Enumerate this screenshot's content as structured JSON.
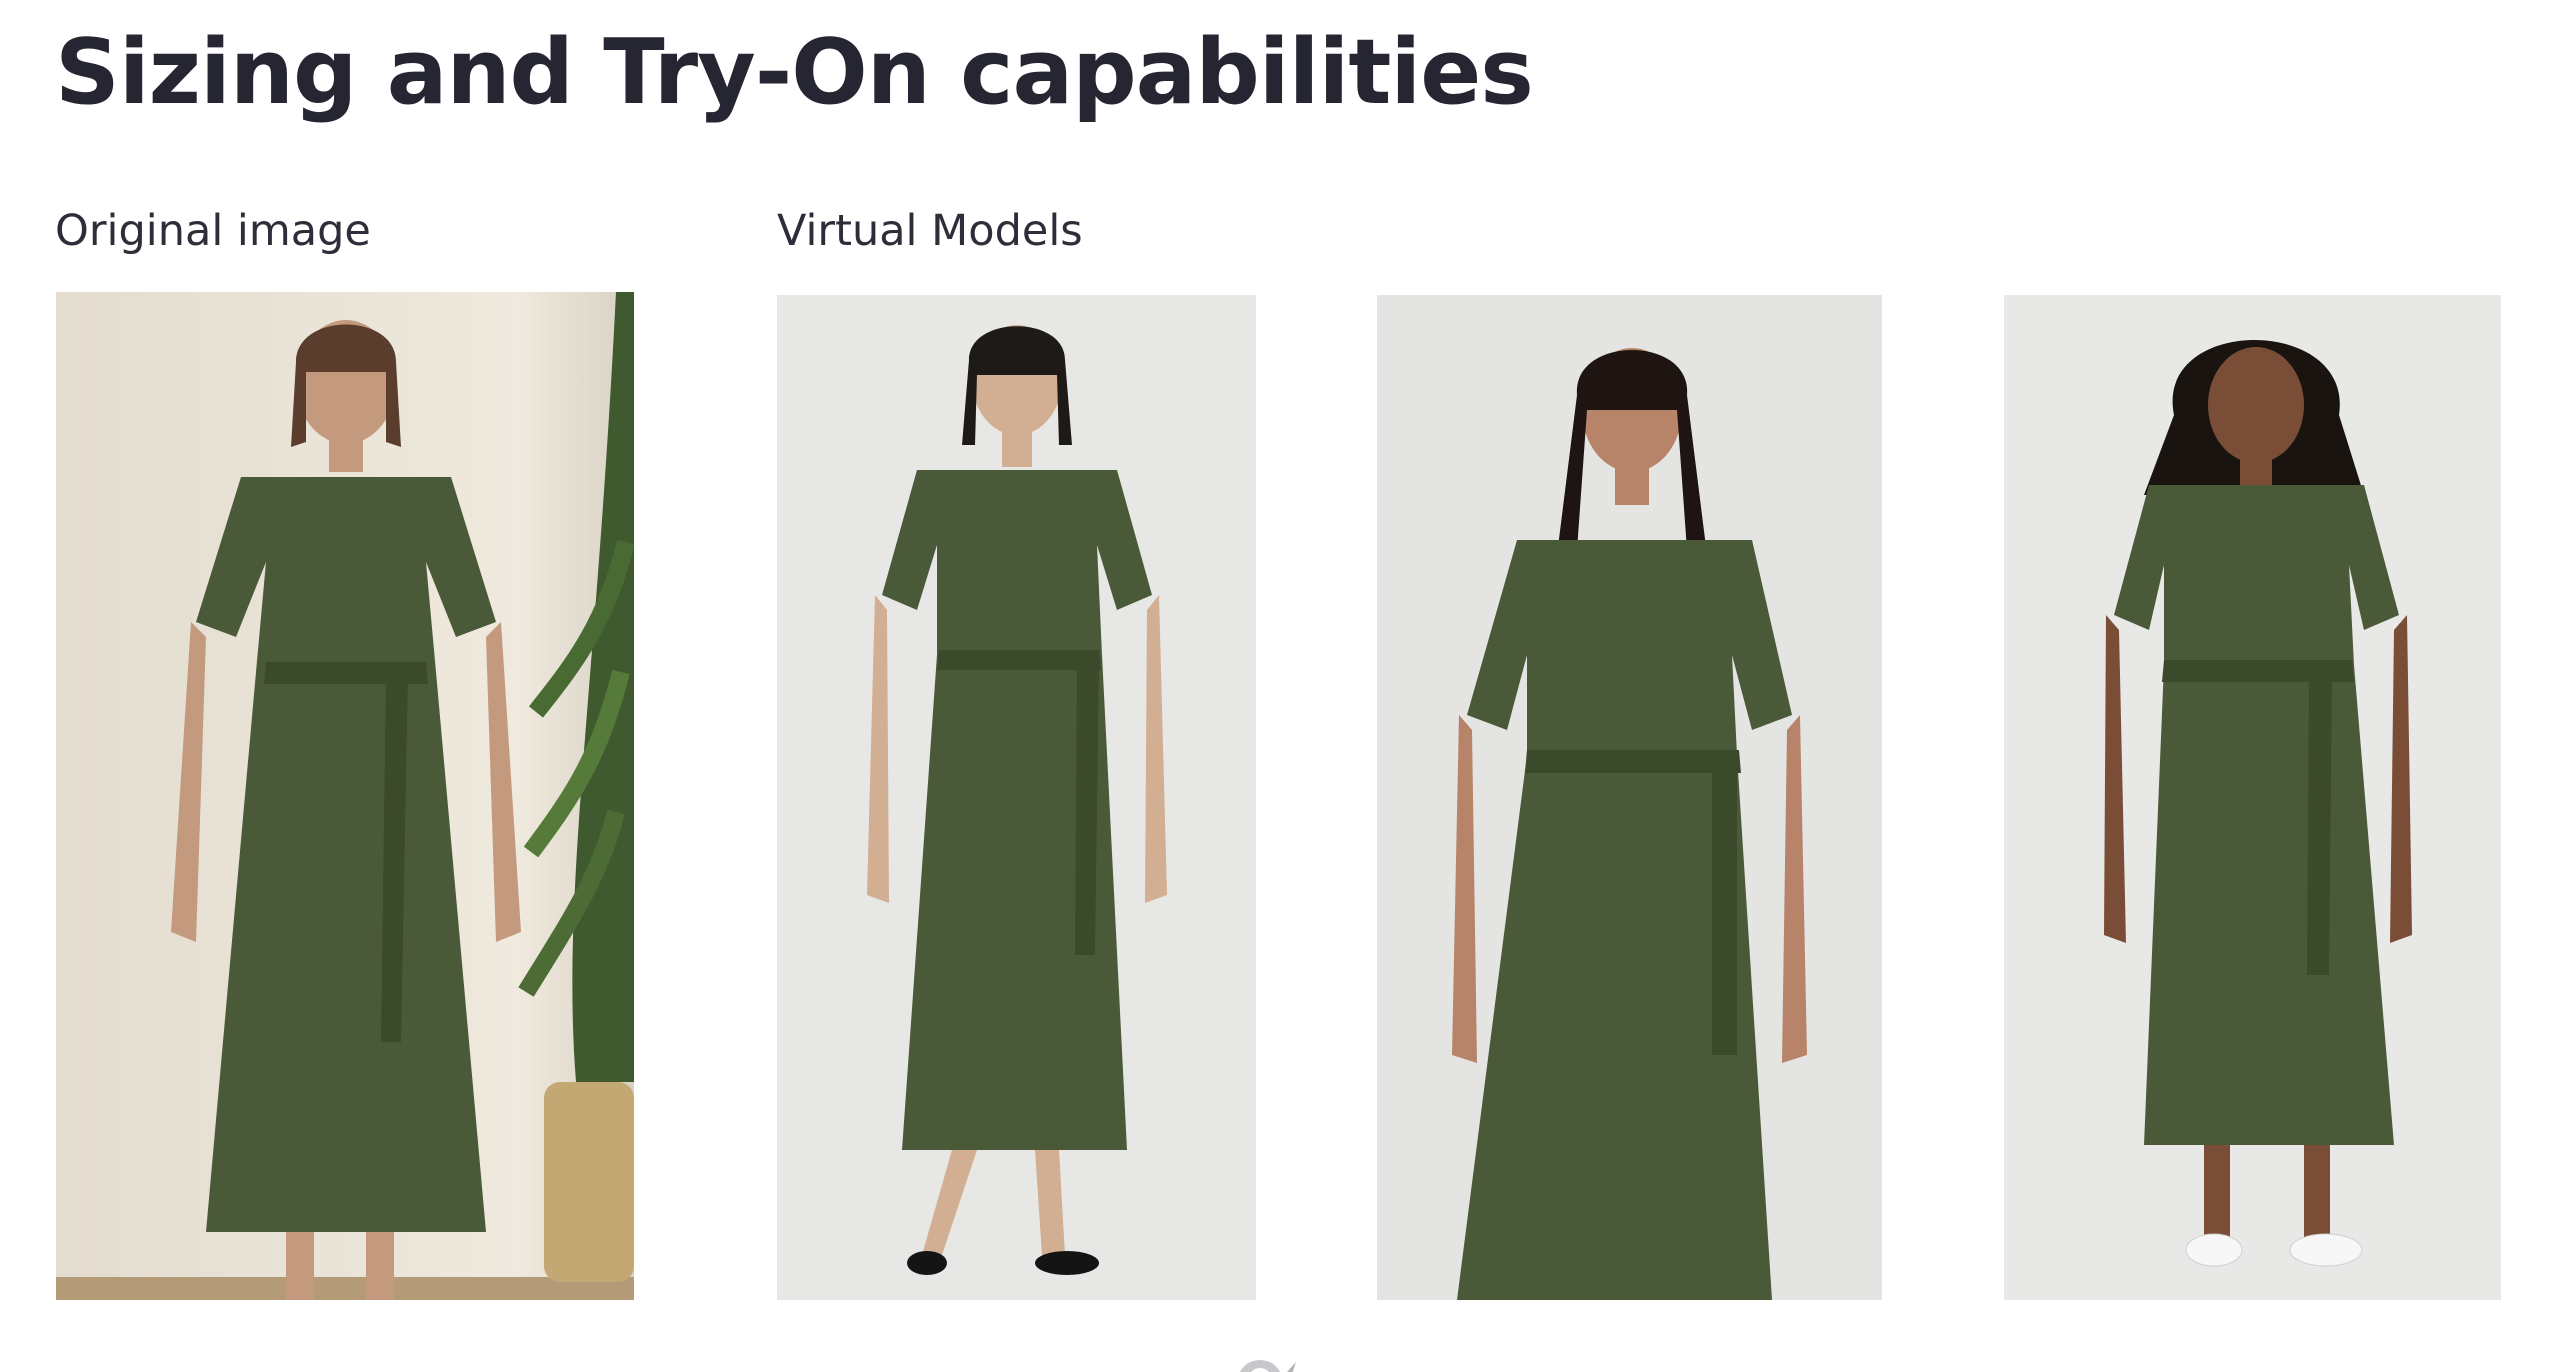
{
  "page": {
    "title": "Sizing and Try-On capabilities"
  },
  "sections": {
    "original_label": "Original image",
    "virtual_label": "Virtual Models"
  },
  "images": [
    {
      "name": "original-photo",
      "description_icon": "person-in-green-wrap-dress-with-plant"
    },
    {
      "name": "virtual-model-1",
      "description_icon": "person-in-green-wrap-dress-black-flats"
    },
    {
      "name": "virtual-model-2",
      "description_icon": "person-in-green-wrap-dress"
    },
    {
      "name": "virtual-model-3",
      "description_icon": "person-in-green-wrap-dress-white-sneakers"
    }
  ],
  "colors": {
    "dress": "#4a5a38",
    "dress_shadow": "#3c4a2c",
    "title_text": "#262633",
    "background": "#ffffff",
    "studio_bg": "#e6e6e4",
    "original_bg": "#e9e2d6"
  }
}
